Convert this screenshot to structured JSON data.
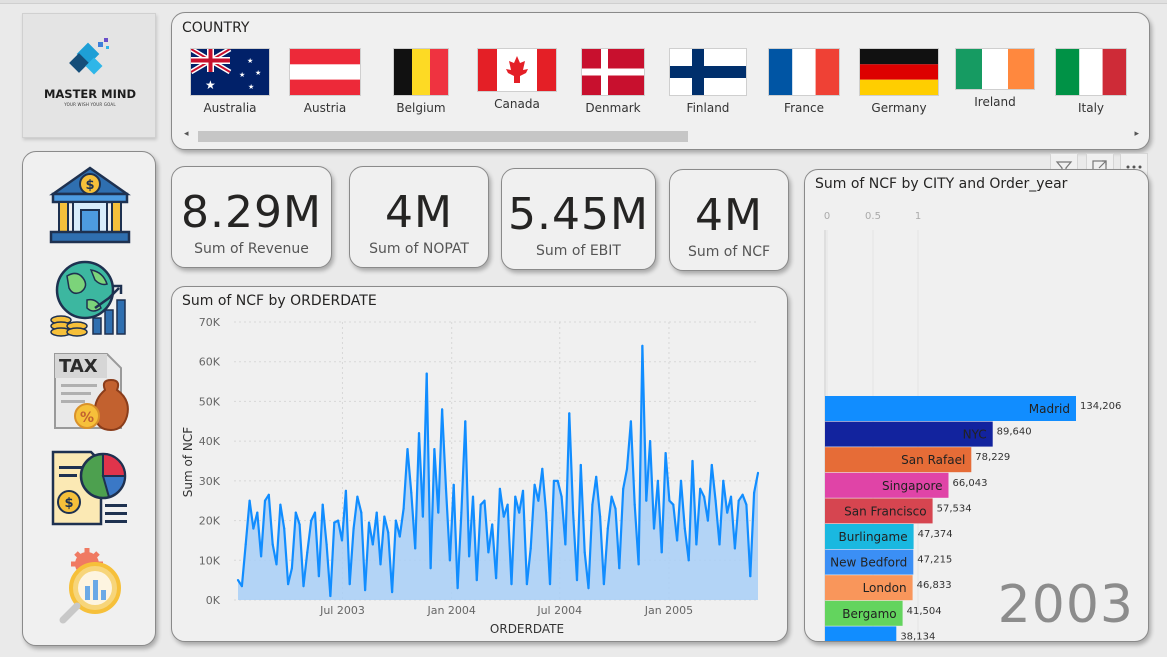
{
  "brand": {
    "name": "MASTER MIND",
    "tagline": "YOUR WISH YOUR GOAL"
  },
  "slicer": {
    "title": "COUNTRY",
    "countries": [
      "Australia",
      "Austria",
      "Belgium",
      "Canada",
      "Denmark",
      "Finland",
      "France",
      "Germany",
      "Ireland",
      "Italy"
    ]
  },
  "nav": [
    {
      "icon": "bank-dollar-icon"
    },
    {
      "icon": "globe-growth-icon"
    },
    {
      "icon": "tax-document-icon"
    },
    {
      "icon": "financial-report-icon"
    },
    {
      "icon": "analytics-search-icon"
    }
  ],
  "kpis": [
    {
      "value": "8.29M",
      "label": "Sum of Revenue"
    },
    {
      "value": "4M",
      "label": "Sum of NOPAT"
    },
    {
      "value": "5.45M",
      "label": "Sum of EBIT"
    },
    {
      "value": "4M",
      "label": "Sum of NCF"
    }
  ],
  "colors": {
    "line": "#118dff",
    "area": "#a8cff7",
    "bars": [
      "#118dff",
      "#12239e",
      "#e66c37",
      "#e044a7",
      "#d64550",
      "#1ab8e0",
      "#3b8ff5",
      "#f9965b",
      "#63d45e",
      "#118dff"
    ]
  },
  "chart_data": [
    {
      "type": "area",
      "title": "Sum of NCF by ORDERDATE",
      "xlabel": "ORDERDATE",
      "ylabel": "Sum of NCF",
      "x_range": [
        "2003-01-06",
        "2005-05-31"
      ],
      "ylim": [
        0,
        70000
      ],
      "y_ticks": [
        "0K",
        "10K",
        "20K",
        "30K",
        "40K",
        "50K",
        "60K",
        "70K"
      ],
      "x_ticks": [
        "Jul 2003",
        "Jan 2004",
        "Jul 2004",
        "Jan 2005"
      ],
      "grid": true,
      "values": [
        5000,
        3500,
        14000,
        25000,
        18000,
        22000,
        11000,
        25000,
        26500,
        14000,
        9000,
        24000,
        18000,
        4000,
        8000,
        22000,
        19000,
        3500,
        12000,
        20000,
        22000,
        6000,
        24000,
        14000,
        1000,
        19500,
        20000,
        15000,
        27500,
        4000,
        18000,
        26000,
        22000,
        2500,
        19500,
        14000,
        22000,
        9000,
        21000,
        17000,
        2000,
        20000,
        16000,
        23000,
        38000,
        27000,
        13000,
        42000,
        21000,
        57000,
        8000,
        38000,
        22000,
        48000,
        28000,
        10000,
        29000,
        3000,
        22000,
        45000,
        11000,
        26000,
        5000,
        24000,
        25000,
        12000,
        19000,
        5500,
        28000,
        21000,
        24000,
        4000,
        26000,
        22000,
        27500,
        4000,
        13000,
        29000,
        25000,
        33000,
        22000,
        4000,
        30000,
        30000,
        26000,
        14000,
        47000,
        22000,
        5000,
        34000,
        12000,
        3000,
        24000,
        31000,
        21000,
        4000,
        18000,
        26000,
        23000,
        8000,
        28000,
        33000,
        45000,
        24000,
        9000,
        64000,
        25000,
        40000,
        18000,
        30000,
        12000,
        37000,
        25000,
        24000,
        15000,
        30000,
        18000,
        10000,
        35000,
        14000,
        28000,
        26000,
        20000,
        34000,
        25000,
        14000,
        30000,
        22000,
        26000,
        13000,
        25000,
        26500,
        24000,
        6000,
        27000,
        32000
      ]
    },
    {
      "type": "bar",
      "title": "Sum of NCF by CITY and Order_year",
      "x_ticks": [
        "0",
        "0.5",
        "1"
      ],
      "categories": [
        "Madrid",
        "NYC",
        "San Rafael",
        "Singapore",
        "San Francisco",
        "Burlingame",
        "New Bedford",
        "London",
        "Bergamo",
        ""
      ],
      "values": [
        134206,
        89640,
        78229,
        66043,
        57534,
        47374,
        47215,
        46833,
        41504,
        38134
      ],
      "data_labels": [
        "134,206",
        "89,640",
        "78,229",
        "66,043",
        "57,534",
        "47,374",
        "47,215",
        "46,833",
        "41,504",
        "38,134"
      ],
      "year": "2003"
    }
  ]
}
